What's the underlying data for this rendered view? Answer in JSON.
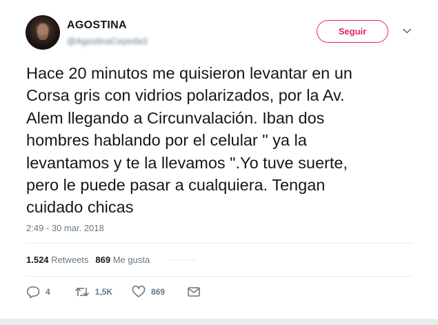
{
  "user": {
    "display_name": "AGOSTINA",
    "handle": "@AgostinaCepeda3"
  },
  "follow_button_label": "Seguir",
  "tweet_text": "Hace 20 minutos me quisieron levantar en un\nCorsa gris con vidrios polarizados, por la Av.\nAlem llegando a Circunvalación. Iban dos\nhombres hablando por el celular \" ya la\nlevantamos y te la llevamos \".Yo tuve suerte,\npero le puede pasar a cualquiera. Tengan\ncuidado chicas",
  "timestamp": "2:49 - 30 mar. 2018",
  "stats": {
    "retweets_count": "1.524",
    "retweets_label": "Retweets",
    "likes_count": "869",
    "likes_label": "Me gusta"
  },
  "actions": {
    "reply_count": "4",
    "retweet_count": "1,5K",
    "like_count": "869"
  },
  "colors": {
    "accent": "#e0245e",
    "text": "#14171a",
    "muted": "#657786",
    "divider": "#e6ecf0"
  },
  "icons": [
    "chevron-down-icon",
    "reply-icon",
    "retweet-icon",
    "heart-icon",
    "message-icon"
  ]
}
